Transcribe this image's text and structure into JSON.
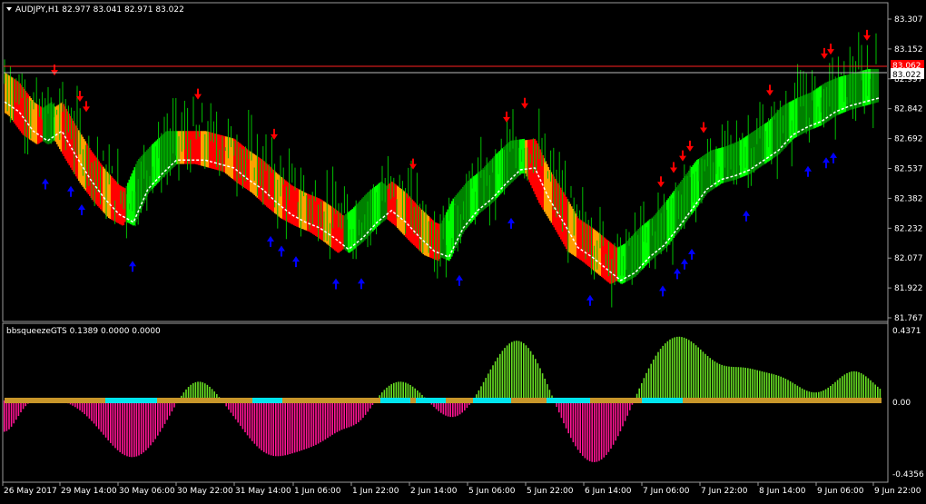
{
  "main_chart": {
    "header": "AUDJPY,H1  82.977 83.041 82.971 83.022",
    "price_axis_labels": [
      "83.307",
      "83.152",
      "82.997",
      "82.842",
      "82.692",
      "82.537",
      "82.382",
      "82.232",
      "82.077",
      "81.922",
      "81.767"
    ],
    "current_price": "83.022",
    "red_line_price": "83.062"
  },
  "indicator": {
    "header": "bbsqueezeGTS 0.1389 0.0000 0.0000",
    "axis_labels": [
      "0.4371",
      "0.00",
      "-0.4356"
    ]
  },
  "time_axis": [
    "26 May 2017",
    "29 May 14:00",
    "30 May 06:00",
    "30 May 22:00",
    "31 May 14:00",
    "1 Jun 06:00",
    "1 Jun 22:00",
    "2 Jun 14:00",
    "5 Jun 06:00",
    "5 Jun 22:00",
    "6 Jun 14:00",
    "7 Jun 06:00",
    "7 Jun 22:00",
    "8 Jun 14:00",
    "9 Jun 06:00",
    "9 Jun 22:00"
  ],
  "colors": {
    "background": "#000000",
    "bar": "#00c000",
    "band_red": "#ff0000",
    "band_orange": "#ffa000",
    "band_darkgreen": "#008000",
    "band_lime": "#00ff00",
    "arrow_up": "#0000ff",
    "arrow_down": "#ff0000",
    "hist_pos": "#66dd22",
    "hist_neg": "#ff1493",
    "squeeze_on": "#00e5ee",
    "squeeze_off": "#c8962a",
    "axis_text": "#ffffff"
  },
  "chart_data": {
    "type": "line",
    "title": "AUDJPY,H1",
    "ylim": [
      81.767,
      83.307
    ],
    "series": [
      {
        "values": [
          83.0,
          82.95,
          82.85,
          82.8,
          82.85,
          82.72,
          82.6,
          82.5,
          82.42,
          82.38,
          82.55,
          82.63,
          82.7,
          82.7,
          82.7,
          82.68,
          82.66,
          82.6,
          82.55,
          82.48,
          82.42,
          82.38,
          82.35,
          82.3,
          82.24,
          82.3,
          82.38,
          82.44,
          82.38,
          82.3,
          82.23,
          82.2,
          82.35,
          82.44,
          82.5,
          82.58,
          82.65,
          82.66,
          82.5,
          82.38,
          82.25,
          82.2,
          82.14,
          82.08,
          82.12,
          82.2,
          82.26,
          82.35,
          82.45,
          82.55,
          82.6,
          82.62,
          82.65,
          82.7,
          82.75,
          82.83,
          82.87,
          82.9,
          82.95,
          82.98,
          83.0,
          83.02
        ]
      }
    ]
  }
}
